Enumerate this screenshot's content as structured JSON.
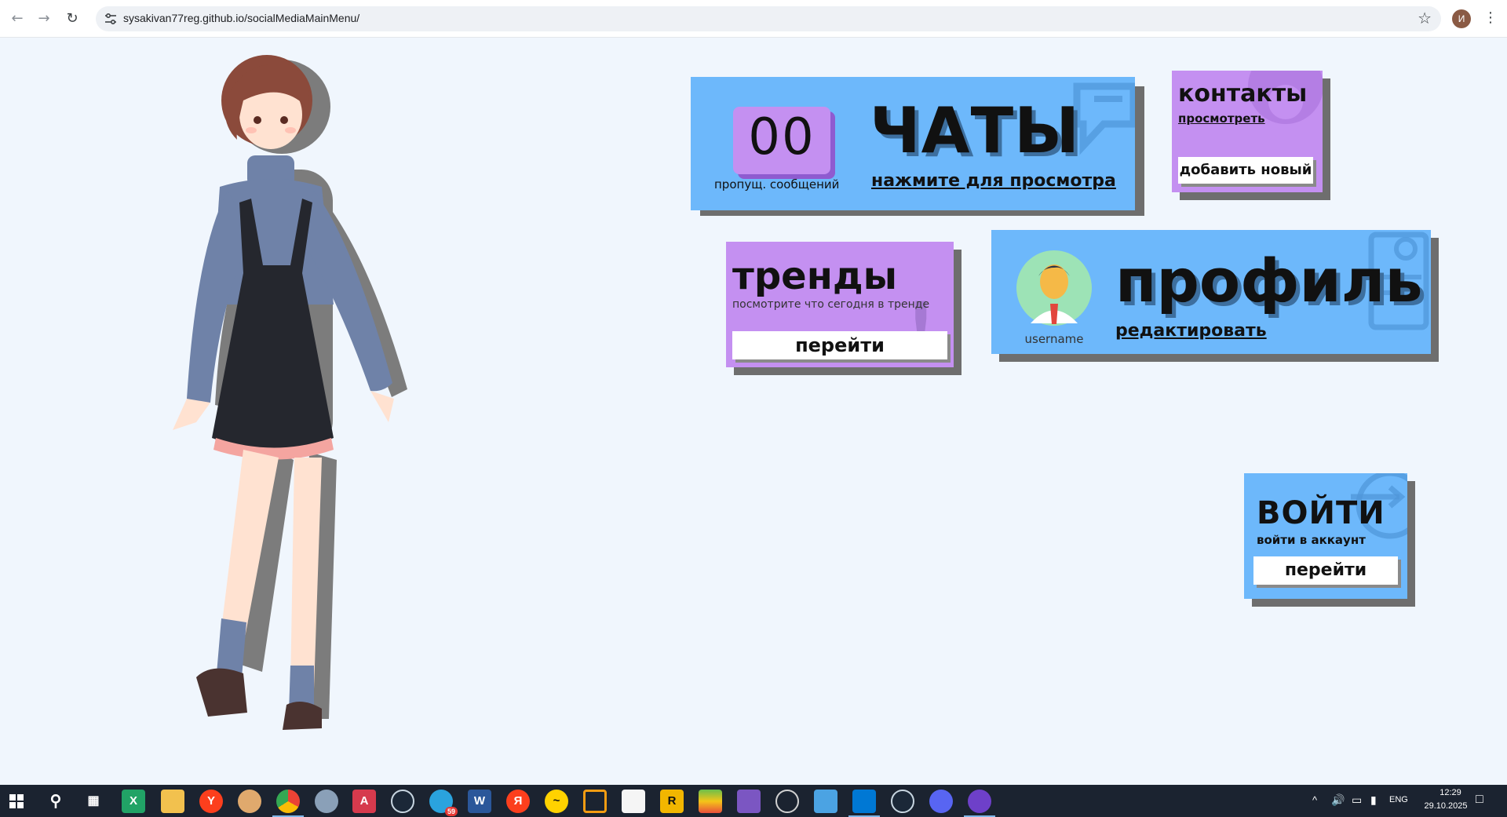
{
  "browser": {
    "url": "sysakivan77reg.github.io/socialMediaMainMenu/",
    "profile_initial": "И",
    "back_icon": "arrow-left-icon",
    "forward_icon": "arrow-right-icon",
    "reload_icon": "reload-icon",
    "bookmark_icon": "star-icon"
  },
  "chats": {
    "count": "00",
    "count_label": "пропущ. сообщений",
    "title": "ЧАТЫ",
    "link": "нажмите для просмотра"
  },
  "contacts": {
    "title": "контакты",
    "link": "просмотреть",
    "button": "добавить новый"
  },
  "trends": {
    "title": "тренды",
    "subtitle": "посмотрите что сегодня в тренде",
    "button": "перейти"
  },
  "profile": {
    "username": "username",
    "title": "профиль",
    "link": "редактировать"
  },
  "login": {
    "title": "ВОЙТИ",
    "subtitle": "войти в аккаунт",
    "button": "перейти"
  },
  "colors": {
    "blue_card": "#6db8fb",
    "purple_card": "#c490f1",
    "card_shadow": "#6e6e6e",
    "page_bg": "#f0f6fd"
  },
  "taskbar": {
    "language": "ENG",
    "time": "12:29",
    "date": "29.10.2025",
    "telegram_badge": "59",
    "apps": [
      "start-icon",
      "search-icon",
      "task-view-icon",
      "excel-icon",
      "file-explorer-icon",
      "yandex-browser-icon",
      "paint-icon",
      "chrome-icon",
      "settings-icon",
      "acrobat-icon",
      "steam-icon",
      "telegram-icon",
      "word-icon",
      "yandex-icon",
      "yandex-market-icon",
      "vm-icon",
      "notepad-icon",
      "rustdesk-icon",
      "bluestacks-icon",
      "visual-studio-icon",
      "unity-icon",
      "control-panel-icon",
      "vscode-icon",
      "steam-icon-2",
      "discord-icon",
      "github-desktop-icon"
    ]
  }
}
